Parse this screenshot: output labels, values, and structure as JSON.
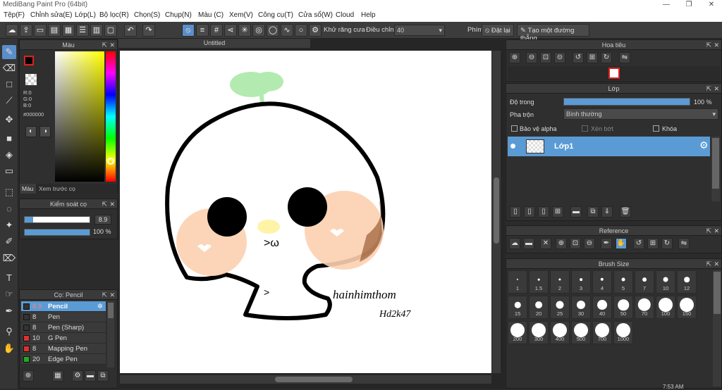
{
  "window": {
    "title": "MediBang Paint Pro (64bit)"
  },
  "menu": [
    "Tệp(F)",
    "Chỉnh sửa(E)",
    "Lớp(L)",
    "Bộ lọc(R)",
    "Chọn(S)",
    "Chụp(N)",
    "Màu (C)",
    "Xem(V)",
    "Công cụ(T)",
    "Cửa sổ(W)",
    "Cloud",
    "Help"
  ],
  "toolbar": {
    "antialias_label": "Khử răng cưa",
    "adjust_label": "Điều chỉnh",
    "adjust_value": "40",
    "phim_label": "Phím",
    "reset_label": "Đặt lại",
    "straight_label": "Tạo một đường thẳng"
  },
  "color_panel": {
    "title": "Màu",
    "r": "R:0",
    "g": "G:0",
    "b": "B:0",
    "hex": "#000000",
    "tab_color": "Màu",
    "tab_preview": "Xem trước cọ"
  },
  "brush_control": {
    "title": "Kiểm soát cọ",
    "size": "8.9",
    "size_fraction": 0.13,
    "opacity": "100 %",
    "opacity_fraction": 1.0
  },
  "brush_list": {
    "title": "Cọ: Pencil",
    "items": [
      {
        "size": "8.9",
        "name": "Pencil",
        "color": "#333333",
        "selected": true
      },
      {
        "size": "8",
        "name": "Pen",
        "color": "#333333",
        "selected": false
      },
      {
        "size": "8",
        "name": "Pen (Sharp)",
        "color": "#333333",
        "selected": false
      },
      {
        "size": "10",
        "name": "G Pen",
        "color": "#e03030",
        "selected": false
      },
      {
        "size": "8",
        "name": "Mapping Pen",
        "color": "#e03030",
        "selected": false
      },
      {
        "size": "20",
        "name": "Edge Pen",
        "color": "#22aa22",
        "selected": false
      }
    ]
  },
  "canvas": {
    "tab_title": "Untitled",
    "signature_line1": "hainhimthom",
    "signature_line2": "Hd2k47",
    "mouth_text": ">ω",
    "belly_text": ">"
  },
  "navigator": {
    "title": "Hoa tiêu"
  },
  "layer_panel": {
    "title": "Lớp",
    "opacity_label": "Độ trong",
    "opacity_value": "100 %",
    "opacity_fraction": 1.0,
    "blend_label": "Pha trộn",
    "blend_value": "Bình thường",
    "protect_alpha": "Bảo vệ alpha",
    "clipping": "Xén bớt",
    "lock": "Khóa",
    "layer_name": "Lớp1"
  },
  "reference_panel": {
    "title": "Reference"
  },
  "brush_size_panel": {
    "title": "Brush Size",
    "sizes": [
      "1",
      "1.5",
      "2",
      "3",
      "4",
      "5",
      "7",
      "10",
      "12",
      "15",
      "20",
      "25",
      "30",
      "40",
      "50",
      "70",
      "100",
      "150",
      "200",
      "300",
      "400",
      "500",
      "700",
      "1000"
    ]
  },
  "taskbar": {
    "clock": "7:53 AM"
  }
}
